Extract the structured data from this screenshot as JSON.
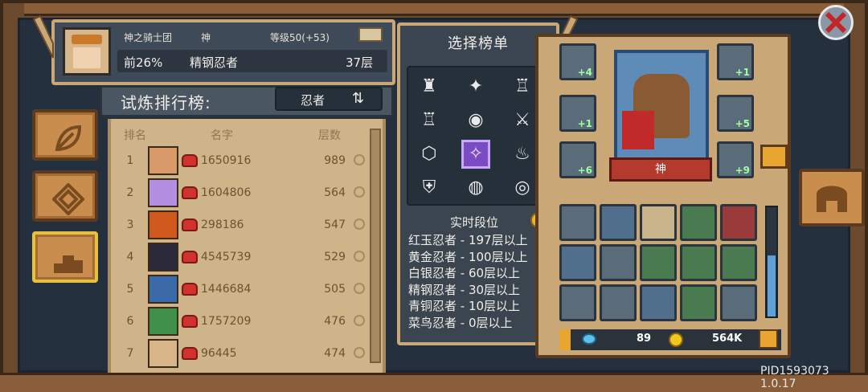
{
  "header": {
    "guild": "神之骑士团",
    "title_badge": "神",
    "level": "等级50(+53)",
    "percentile": "前26%",
    "current_tier": "精钢忍者",
    "current_floor": "37层"
  },
  "trial": {
    "title": "试炼排行榜:",
    "dropdown_value": "忍者"
  },
  "table": {
    "col_rank": "排名",
    "col_name": "名字",
    "col_floor": "层数",
    "rows": [
      {
        "rank": "1",
        "uid": "1650916",
        "floor": "989",
        "face": "#d99a6a"
      },
      {
        "rank": "2",
        "uid": "1604806",
        "floor": "564",
        "face": "#b48ee0"
      },
      {
        "rank": "3",
        "uid": "298186",
        "floor": "547",
        "face": "#d05a1e"
      },
      {
        "rank": "4",
        "uid": "4545739",
        "floor": "529",
        "face": "#2c2a3a"
      },
      {
        "rank": "5",
        "uid": "1446684",
        "floor": "505",
        "face": "#3a6aa8"
      },
      {
        "rank": "6",
        "uid": "1757209",
        "floor": "476",
        "face": "#3f8f4a"
      },
      {
        "rank": "7",
        "uid": "96445",
        "floor": "474",
        "face": "#d9b68a"
      }
    ]
  },
  "popup": {
    "title": "选择榜单",
    "realtime_title": "实时段位",
    "tiers": [
      "红玉忍者 - 197层以上",
      "黄金忍者 - 100层以上",
      "白银忍者 - 60层以上",
      "精钢忍者 - 30层以上",
      "青铜忍者 - 10层以上",
      "菜鸟忍者 - 0层以上"
    ],
    "grid_icons": [
      "knight-class-icon",
      "rogue-class-icon",
      "castle-class-icon",
      "tower-class-icon",
      "swirl-class-icon",
      "slash-class-icon",
      "badge-class-icon",
      "ninja-class-icon",
      "flame-class-icon",
      "shield-class-icon",
      "vortex-class-icon",
      "spiral-class-icon"
    ],
    "grid_glyphs": [
      "♜",
      "✦",
      "♖",
      "♖",
      "◉",
      "⚔",
      "⬡",
      "✧",
      "♨",
      "⛨",
      "◍",
      "◎"
    ]
  },
  "character": {
    "name": "神",
    "slots": [
      {
        "badge": "+4"
      },
      {
        "badge": "+1"
      },
      {
        "badge": "+1"
      },
      {
        "badge": "+5"
      },
      {
        "badge": "+6"
      },
      {
        "badge": "+9"
      }
    ],
    "inventory_colors": [
      "#5a6b7a",
      "#4f6f8c",
      "#c9b38a",
      "#4a7a50",
      "#9a3a3a",
      "#4f6f8c",
      "#5a6b7a",
      "#4a7a50",
      "#4a7a50",
      "#4a7a50",
      "#5a6b7a",
      "#5a6b7a",
      "#4f6f8c",
      "#4a7a50",
      "#5a6b7a"
    ]
  },
  "resources": {
    "gems": "89",
    "gold": "564K"
  },
  "version": "PID1593073 1.0.17"
}
